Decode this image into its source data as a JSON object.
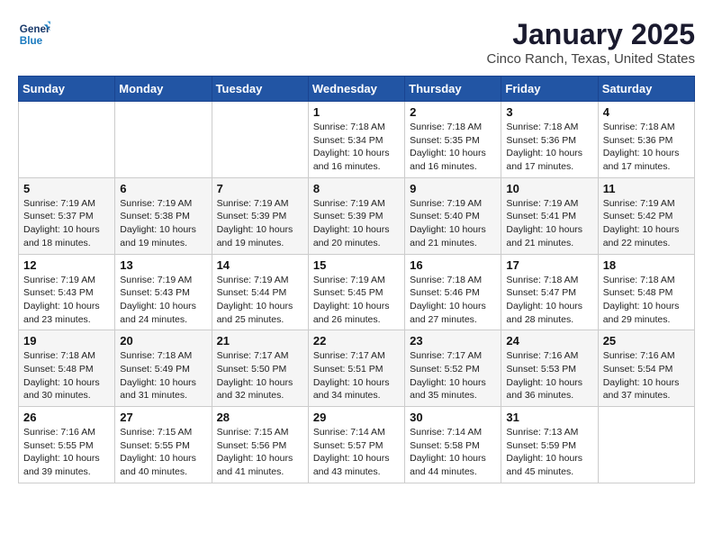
{
  "header": {
    "logo_line1": "General",
    "logo_line2": "Blue",
    "title": "January 2025",
    "subtitle": "Cinco Ranch, Texas, United States"
  },
  "days_of_week": [
    "Sunday",
    "Monday",
    "Tuesday",
    "Wednesday",
    "Thursday",
    "Friday",
    "Saturday"
  ],
  "weeks": [
    [
      {
        "day": "",
        "info": ""
      },
      {
        "day": "",
        "info": ""
      },
      {
        "day": "",
        "info": ""
      },
      {
        "day": "1",
        "info": "Sunrise: 7:18 AM\nSunset: 5:34 PM\nDaylight: 10 hours\nand 16 minutes."
      },
      {
        "day": "2",
        "info": "Sunrise: 7:18 AM\nSunset: 5:35 PM\nDaylight: 10 hours\nand 16 minutes."
      },
      {
        "day": "3",
        "info": "Sunrise: 7:18 AM\nSunset: 5:36 PM\nDaylight: 10 hours\nand 17 minutes."
      },
      {
        "day": "4",
        "info": "Sunrise: 7:18 AM\nSunset: 5:36 PM\nDaylight: 10 hours\nand 17 minutes."
      }
    ],
    [
      {
        "day": "5",
        "info": "Sunrise: 7:19 AM\nSunset: 5:37 PM\nDaylight: 10 hours\nand 18 minutes."
      },
      {
        "day": "6",
        "info": "Sunrise: 7:19 AM\nSunset: 5:38 PM\nDaylight: 10 hours\nand 19 minutes."
      },
      {
        "day": "7",
        "info": "Sunrise: 7:19 AM\nSunset: 5:39 PM\nDaylight: 10 hours\nand 19 minutes."
      },
      {
        "day": "8",
        "info": "Sunrise: 7:19 AM\nSunset: 5:39 PM\nDaylight: 10 hours\nand 20 minutes."
      },
      {
        "day": "9",
        "info": "Sunrise: 7:19 AM\nSunset: 5:40 PM\nDaylight: 10 hours\nand 21 minutes."
      },
      {
        "day": "10",
        "info": "Sunrise: 7:19 AM\nSunset: 5:41 PM\nDaylight: 10 hours\nand 21 minutes."
      },
      {
        "day": "11",
        "info": "Sunrise: 7:19 AM\nSunset: 5:42 PM\nDaylight: 10 hours\nand 22 minutes."
      }
    ],
    [
      {
        "day": "12",
        "info": "Sunrise: 7:19 AM\nSunset: 5:43 PM\nDaylight: 10 hours\nand 23 minutes."
      },
      {
        "day": "13",
        "info": "Sunrise: 7:19 AM\nSunset: 5:43 PM\nDaylight: 10 hours\nand 24 minutes."
      },
      {
        "day": "14",
        "info": "Sunrise: 7:19 AM\nSunset: 5:44 PM\nDaylight: 10 hours\nand 25 minutes."
      },
      {
        "day": "15",
        "info": "Sunrise: 7:19 AM\nSunset: 5:45 PM\nDaylight: 10 hours\nand 26 minutes."
      },
      {
        "day": "16",
        "info": "Sunrise: 7:18 AM\nSunset: 5:46 PM\nDaylight: 10 hours\nand 27 minutes."
      },
      {
        "day": "17",
        "info": "Sunrise: 7:18 AM\nSunset: 5:47 PM\nDaylight: 10 hours\nand 28 minutes."
      },
      {
        "day": "18",
        "info": "Sunrise: 7:18 AM\nSunset: 5:48 PM\nDaylight: 10 hours\nand 29 minutes."
      }
    ],
    [
      {
        "day": "19",
        "info": "Sunrise: 7:18 AM\nSunset: 5:48 PM\nDaylight: 10 hours\nand 30 minutes."
      },
      {
        "day": "20",
        "info": "Sunrise: 7:18 AM\nSunset: 5:49 PM\nDaylight: 10 hours\nand 31 minutes."
      },
      {
        "day": "21",
        "info": "Sunrise: 7:17 AM\nSunset: 5:50 PM\nDaylight: 10 hours\nand 32 minutes."
      },
      {
        "day": "22",
        "info": "Sunrise: 7:17 AM\nSunset: 5:51 PM\nDaylight: 10 hours\nand 34 minutes."
      },
      {
        "day": "23",
        "info": "Sunrise: 7:17 AM\nSunset: 5:52 PM\nDaylight: 10 hours\nand 35 minutes."
      },
      {
        "day": "24",
        "info": "Sunrise: 7:16 AM\nSunset: 5:53 PM\nDaylight: 10 hours\nand 36 minutes."
      },
      {
        "day": "25",
        "info": "Sunrise: 7:16 AM\nSunset: 5:54 PM\nDaylight: 10 hours\nand 37 minutes."
      }
    ],
    [
      {
        "day": "26",
        "info": "Sunrise: 7:16 AM\nSunset: 5:55 PM\nDaylight: 10 hours\nand 39 minutes."
      },
      {
        "day": "27",
        "info": "Sunrise: 7:15 AM\nSunset: 5:55 PM\nDaylight: 10 hours\nand 40 minutes."
      },
      {
        "day": "28",
        "info": "Sunrise: 7:15 AM\nSunset: 5:56 PM\nDaylight: 10 hours\nand 41 minutes."
      },
      {
        "day": "29",
        "info": "Sunrise: 7:14 AM\nSunset: 5:57 PM\nDaylight: 10 hours\nand 43 minutes."
      },
      {
        "day": "30",
        "info": "Sunrise: 7:14 AM\nSunset: 5:58 PM\nDaylight: 10 hours\nand 44 minutes."
      },
      {
        "day": "31",
        "info": "Sunrise: 7:13 AM\nSunset: 5:59 PM\nDaylight: 10 hours\nand 45 minutes."
      },
      {
        "day": "",
        "info": ""
      }
    ]
  ]
}
